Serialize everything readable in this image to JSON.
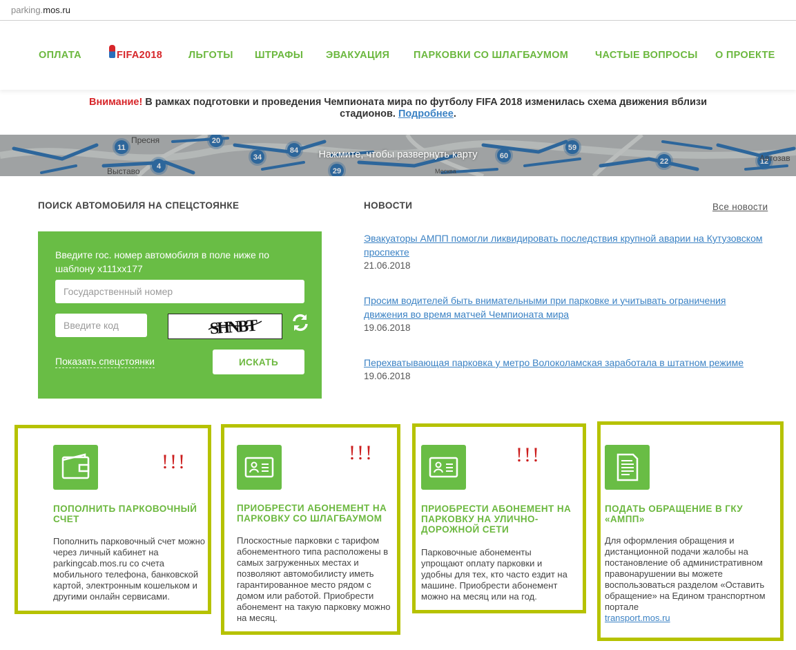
{
  "browser": {
    "url_gray": "parking.",
    "url_dark": "mos.ru"
  },
  "nav": {
    "items": [
      "ОПЛАТА",
      "FIFA2018",
      "ЛЬГОТЫ",
      "ШТРАФЫ",
      "ЭВАКУАЦИЯ",
      "ПАРКОВКИ СО ШЛАГБАУМОМ",
      "ЧАСТЫЕ ВОПРОСЫ",
      "О ПРОЕКТЕ"
    ]
  },
  "alert": {
    "lead": "Внимание!",
    "text": " В рамках подготовки и проведения Чемпионата мира по футболу FIFA 2018 изменилась схема движения вблизи",
    "text2": "стадионов. ",
    "link": "Подробнее",
    "end": "."
  },
  "map": {
    "caption": "Нажмите, чтобы развернуть карту",
    "labels": [
      "Пресня",
      "Выставо",
      "11",
      "4",
      "20",
      "34",
      "84",
      "29",
      "60",
      "59",
      "22",
      "12",
      "Москва",
      "Автозав"
    ]
  },
  "search": {
    "title": "ПОИСК АВТОМОБИЛЯ НА СПЕЦСТОЯНКЕ",
    "hint": "Введите гос. номер автомобиля в поле ниже по шаблону х111хх177",
    "plate_placeholder": "Государственный номер",
    "code_placeholder": "Введите код",
    "captcha_text": "SHNBT",
    "show_lots": "Показать спецстоянки",
    "button": "ИСКАТЬ"
  },
  "news": {
    "title": "НОВОСТИ",
    "all_link": "Все новости",
    "items": [
      {
        "text": "Эвакуаторы АМПП помогли ликвидировать последствия крупной аварии на Кутузовском проспекте",
        "date": "21.06.2018"
      },
      {
        "text": "Просим водителей быть внимательными при парковке и учитывать ограничения движения во время матчей Чемпионата мира",
        "date": "19.06.2018"
      },
      {
        "text": "Перехватывающая парковка у метро Волоколамская заработала в штатном режиме",
        "date": "19.06.2018"
      }
    ]
  },
  "cards": [
    {
      "icon": "wallet-icon",
      "mark": "!!!",
      "title": "ПОПОЛНИТЬ ПАРКОВОЧНЫЙ СЧЕТ",
      "text": "Пополнить парковочный счет можно через личный кабинет на parkingcab.mos.ru со счета мобильного телефона, банковской картой, электронным кошельком и другими онлайн сервисами."
    },
    {
      "icon": "id-card-icon",
      "mark": "!!!",
      "title": "ПРИОБРЕСТИ АБОНЕМЕНТ НА ПАРКОВКУ СО ШЛАГБАУМОМ",
      "text": "Плоскостные парковки с тарифом абонементного типа расположены в самых загруженных местах и позволяют автомобилисту иметь гарантированное место рядом с домом или работой. Приобрести абонемент на такую парковку можно на месяц."
    },
    {
      "icon": "id-card-icon",
      "mark": "!!!",
      "title": "ПРИОБРЕСТИ АБОНЕМЕНТ НА ПАРКОВКУ НА УЛИЧНО-ДОРОЖНОЙ СЕТИ",
      "text": "Парковочные абонементы упрощают оплату парковки и удобны для тех, кто часто ездит на машине. Приобрести абонемент можно на месяц или на год."
    },
    {
      "icon": "document-icon",
      "title": "ПОДАТЬ ОБРАЩЕНИЕ В ГКУ «АМПП»",
      "text": "Для оформления обращения и дистанционной подачи жалобы на постановление об административном правонарушении вы можете воспользоваться разделом «Оставить обращение» на Едином транспортном портале",
      "link": "transport.mos.ru"
    }
  ],
  "colors": {
    "brand_green": "#69bd45",
    "nav_green": "#6cb83f",
    "alert_red": "#d7262a",
    "link_blue": "#3b82c4",
    "card_border": "#b6c200"
  }
}
